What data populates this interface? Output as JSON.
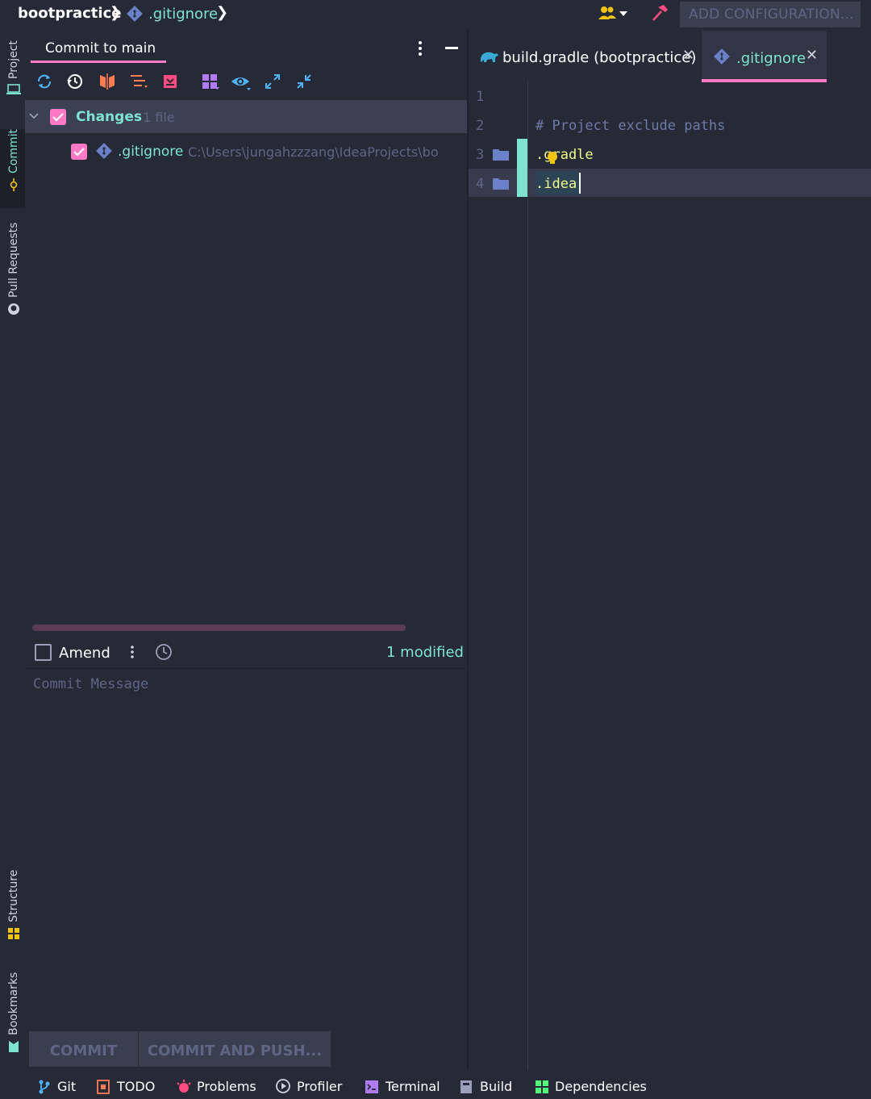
{
  "breadcrumb": {
    "project": "bootpractice",
    "file": ".gitignore"
  },
  "toolbar_right": {
    "config_label": "ADD CONFIGURATION..."
  },
  "left_tools": {
    "project": "Project",
    "commit": "Commit",
    "pull_requests": "Pull Requests",
    "structure": "Structure",
    "bookmarks": "Bookmarks"
  },
  "commit_panel": {
    "title": "Commit to main",
    "changes_label": "Changes",
    "changes_count": "1 file",
    "file": {
      "name": ".gitignore",
      "path": "C:\\Users\\jungahzzzang\\IdeaProjects\\bo"
    },
    "amend_label": "Amend",
    "modified": "1 modified",
    "message_placeholder": "Commit Message",
    "commit_button": "COMMIT",
    "commit_push_button": "COMMIT AND PUSH..."
  },
  "editor": {
    "tabs": [
      {
        "label": "build.gradle (bootpractice)"
      },
      {
        "label": ".gitignore"
      }
    ],
    "lines": [
      {
        "num": "1",
        "text": ""
      },
      {
        "num": "2",
        "text": "# Project exclude paths"
      },
      {
        "num": "3",
        "text": ".gradle"
      },
      {
        "num": "4",
        "text": ".idea"
      }
    ]
  },
  "bottom_bar": {
    "git": "Git",
    "todo": "TODO",
    "problems": "Problems",
    "profiler": "Profiler",
    "terminal": "Terminal",
    "build": "Build",
    "dependencies": "Dependencies"
  },
  "colors": {
    "accent": "#ff79c6",
    "teal": "#7ee3d1",
    "background": "#262a37",
    "muted": "#5d6683"
  }
}
